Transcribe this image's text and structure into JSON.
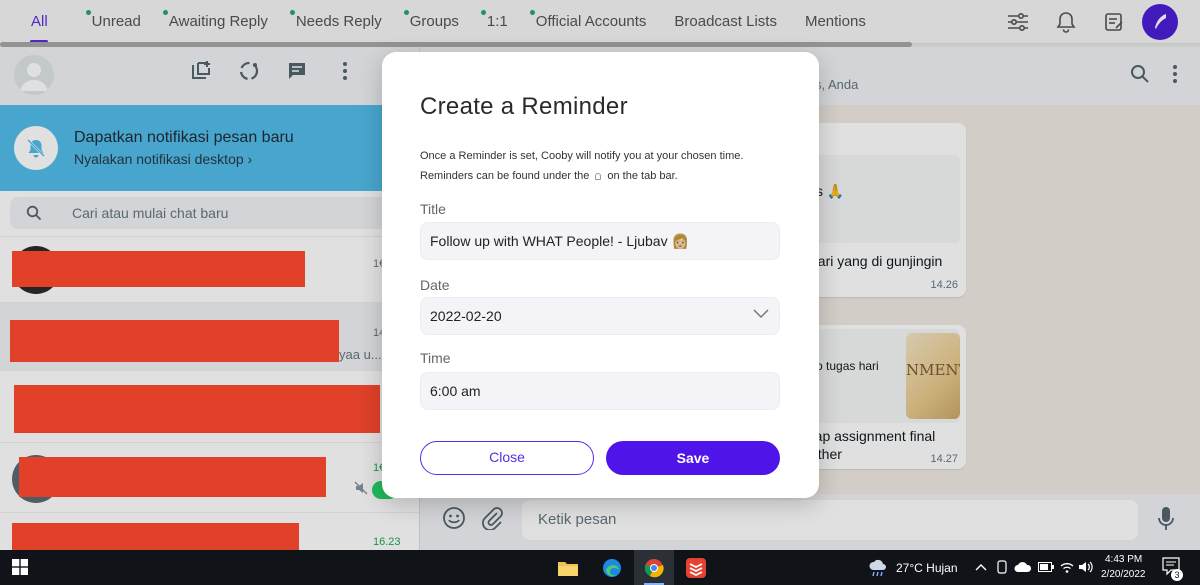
{
  "tabs": [
    {
      "label": "All",
      "active": true,
      "dot": false
    },
    {
      "label": "Unread",
      "active": false,
      "dot": true
    },
    {
      "label": "Awaiting Reply",
      "active": false,
      "dot": true
    },
    {
      "label": "Needs Reply",
      "active": false,
      "dot": true
    },
    {
      "label": "Groups",
      "active": false,
      "dot": true
    },
    {
      "label": "1:1",
      "active": false,
      "dot": true
    },
    {
      "label": "Official Accounts",
      "active": false,
      "dot": true
    },
    {
      "label": "Broadcast Lists",
      "active": false,
      "dot": false
    },
    {
      "label": "Mentions",
      "active": false,
      "dot": false
    }
  ],
  "notification": {
    "title": "Dapatkan notifikasi pesan baru",
    "subtitle": "Nyalakan notifikasi desktop ›"
  },
  "search": {
    "placeholder": "Cari atau mulai chat baru"
  },
  "chats": [
    {
      "time": "1€",
      "preview": ""
    },
    {
      "time": "14",
      "preview": "yaa u..."
    },
    {
      "time": "",
      "preview": ""
    },
    {
      "time": "1€",
      "preview": ""
    },
    {
      "time": "16.23",
      "preview": ""
    }
  ],
  "conversation": {
    "header_sub": "s, Anda",
    "messages": [
      {
        "quoted": "s 🙏",
        "text": "dari yang di gunjingin",
        "time": "14.26"
      },
      {
        "quoted": "p tugas hari",
        "thumb_text": "NMENT",
        "text": "rap assignment final",
        "text2": "ather",
        "time": "14.27"
      }
    ],
    "composer_placeholder": "Ketik pesan"
  },
  "modal": {
    "title": "Create a Reminder",
    "desc_line1": "Once a Reminder is set, Cooby will notify you at your chosen time.",
    "desc_line2a": "Reminders can be found under the",
    "desc_line2b": "on the tab bar.",
    "title_label": "Title",
    "title_value": "Follow up with WHAT People! - Ljubav 👩🏼",
    "date_label": "Date",
    "date_value": "2022-02-20",
    "time_label": "Time",
    "time_value": "6:00 am",
    "close_label": "Close",
    "save_label": "Save"
  },
  "taskbar": {
    "weather": "27°C  Hujan",
    "time": "4:43 PM",
    "date": "2/20/2022",
    "notif_count": "3"
  },
  "colors": {
    "accent": "#4e14e9",
    "notification_bar": "#53bdeb",
    "redaction": "#ff4b2e",
    "unread_dot": "#22a67a"
  }
}
